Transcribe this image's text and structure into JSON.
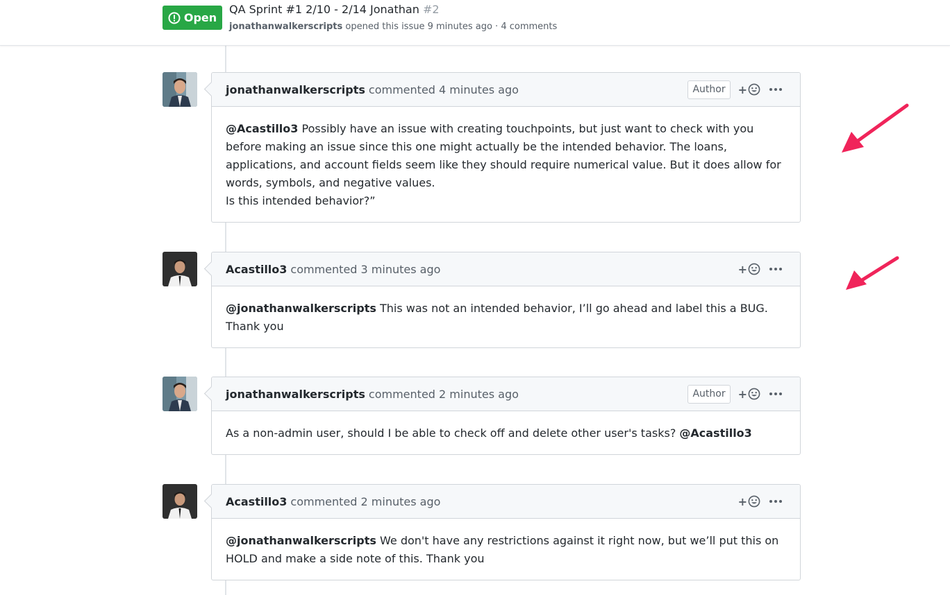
{
  "issue": {
    "state": "Open",
    "title": "QA Sprint #1 2/10 - 2/14 Jonathan",
    "number": "#2",
    "author": "jonathanwalkerscripts",
    "opened_text": "opened this issue 9 minutes ago · 4 comments"
  },
  "comments": [
    {
      "login": "jonathanwalkerscripts",
      "action": "commented 4 minutes ago",
      "badge": "Author",
      "mention": "@Acastillo3",
      "body": " Possibly have an issue with creating touchpoints, but just want to check with you before making an issue since this one might actually be the intended behavior. The loans, applications, and account fields seem like they should require numerical value. But it does allow for words, symbols, and negative values.",
      "body_line2": "Is this intended behavior?”"
    },
    {
      "login": "Acastillo3",
      "action": "commented 3 minutes ago",
      "mention": "@jonathanwalkerscripts",
      "body": " This was not an intended behavior, I’ll go ahead and label this a BUG. Thank you"
    },
    {
      "login": "jonathanwalkerscripts",
      "action": "commented 2 minutes ago",
      "badge": "Author",
      "body": "As a non-admin user, should I be able to check off and delete other user's tasks? ",
      "mention_end": "@Acastillo3"
    },
    {
      "login": "Acastillo3",
      "action": "commented 2 minutes ago",
      "mention": "@jonathanwalkerscripts",
      "body": " We don't have any restrictions against it right now, but we’ll put this on HOLD and make a side note of this. Thank you"
    }
  ],
  "icons": {
    "state": "issue-opened-icon",
    "reaction": "smiley-icon",
    "menu": "kebab-horizontal-icon",
    "annotation": "pointer-arrow"
  },
  "colors": {
    "open_green": "#28a745",
    "annotation_pink": "#f0245a",
    "header_bg": "#f6f8fa",
    "border": "#d1d5da"
  }
}
